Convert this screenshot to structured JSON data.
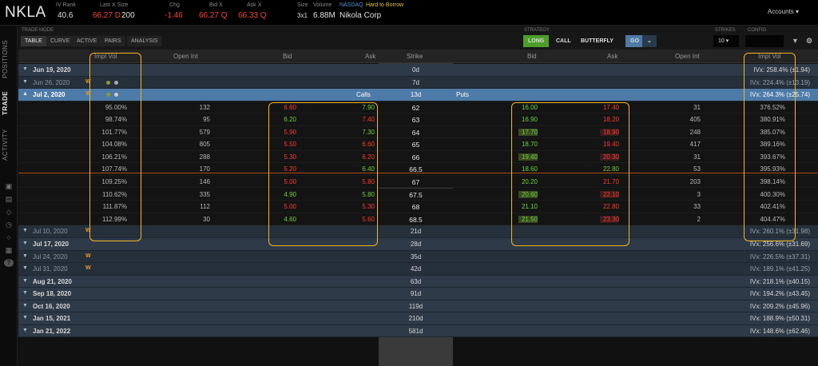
{
  "header": {
    "symbol": "NKLA",
    "iv_rank_label": "IV Rank",
    "iv_rank": "40.6",
    "last_label": "Last X Size",
    "last": "66.27 D",
    "last_size": "200",
    "chg_label": "Chg",
    "chg": "-1.46",
    "bid_label": "Bid X",
    "bid": "66.27 Q",
    "ask_label": "Ask X",
    "ask": "66.33 Q",
    "size_label": "Size",
    "size": "3x1",
    "volume_label": "Volume",
    "volume": "6.88M",
    "exchange": "NASDAQ",
    "htb": "Hard to Borrow",
    "company": "Nikola Corp",
    "accounts": "Accounts"
  },
  "rail": {
    "positions": "POSITIONS",
    "trade": "TRADE",
    "activity": "ACTIVITY"
  },
  "toolbar": {
    "trade_mode_label": "TRADE MODE",
    "modes": [
      "TABLE",
      "CURVE",
      "ACTIVE",
      "PAIRS",
      "ANALYSIS"
    ],
    "strategy_label": "STRATEGY",
    "strategies": [
      "LONG",
      "CALL",
      "BUTTERFLY"
    ],
    "go": "GO",
    "strikes_label": "STRIKES",
    "strikes": "10",
    "config_label": "CONFIG"
  },
  "columns": {
    "impl_vol": "Impl Vol",
    "open_int": "Open Int",
    "bid": "Bid",
    "ask": "Ask",
    "strike": "Strike",
    "bid2": "Bid",
    "ask2": "Ask",
    "open_int2": "Open Int",
    "impl_vol2": "Impl Vol"
  },
  "top_expiries": [
    {
      "date": "Jun 19, 2020",
      "days": "0d",
      "ivx": "IVx: 258.4% (±1.94)",
      "dim": false
    },
    {
      "date": "Jun 26, 2020",
      "days": "7d",
      "ivx": "IVx: 224.4% (±13.19)",
      "dim": true
    }
  ],
  "selected": {
    "date": "Jul 2, 2020",
    "calls": "Calls",
    "days": "13d",
    "puts": "Puts",
    "ivx": "IVx: 264.3% (±25.74)"
  },
  "chain": [
    {
      "civ": "95.00%",
      "coi": "132",
      "cbid": "6.60",
      "cask": "7.90",
      "strike": "62",
      "pbid": "16.00",
      "pask": "17.40",
      "poi": "31",
      "piv": "376.52%"
    },
    {
      "civ": "98.74%",
      "coi": "95",
      "cbid": "6.20",
      "cask": "7.40",
      "strike": "63",
      "pbid": "16.90",
      "pask": "18.20",
      "poi": "405",
      "piv": "380.91%"
    },
    {
      "civ": "101.77%",
      "coi": "579",
      "cbid": "5.90",
      "cask": "7.30",
      "strike": "64",
      "pbid": "17.70",
      "pask": "18.90",
      "poi": "248",
      "piv": "385.07%"
    },
    {
      "civ": "104.08%",
      "coi": "805",
      "cbid": "5.50",
      "cask": "6.60",
      "strike": "65",
      "pbid": "18.70",
      "pask": "19.40",
      "poi": "417",
      "piv": "389.16%"
    },
    {
      "civ": "106.21%",
      "coi": "288",
      "cbid": "5.30",
      "cask": "6.20",
      "strike": "66",
      "pbid": "19.40",
      "pask": "20.30",
      "poi": "31",
      "piv": "393.67%"
    },
    {
      "civ": "107.74%",
      "coi": "170",
      "cbid": "5.20",
      "cask": "6.40",
      "strike": "66.5",
      "pbid": "18.60",
      "pask": "22.80",
      "poi": "53",
      "piv": "395.93%"
    },
    {
      "civ": "109.25%",
      "coi": "146",
      "cbid": "5.00",
      "cask": "5.80",
      "strike": "67",
      "pbid": "20.20",
      "pask": "21.70",
      "poi": "203",
      "piv": "398.14%"
    },
    {
      "civ": "110.62%",
      "coi": "335",
      "cbid": "4.90",
      "cask": "5.80",
      "strike": "67.5",
      "pbid": "20.60",
      "pask": "22.10",
      "poi": "3",
      "piv": "400.30%"
    },
    {
      "civ": "111.87%",
      "coi": "112",
      "cbid": "5.00",
      "cask": "5.30",
      "strike": "68",
      "pbid": "21.10",
      "pask": "22.80",
      "poi": "33",
      "piv": "402.41%"
    },
    {
      "civ": "112.99%",
      "coi": "30",
      "cbid": "4.60",
      "cask": "5.60",
      "strike": "68.5",
      "pbid": "21.50",
      "pask": "23.30",
      "poi": "2",
      "piv": "404.47%"
    }
  ],
  "bottom_expiries": [
    {
      "date": "Jul 10, 2020",
      "days": "21d",
      "ivx": "IVx: 260.1% (±31.98)",
      "dim": true,
      "w": true
    },
    {
      "date": "Jul 17, 2020",
      "days": "28d",
      "ivx": "IVx: 256.6% (±31.69)",
      "dim": false,
      "w": false
    },
    {
      "date": "Jul 24, 2020",
      "days": "35d",
      "ivx": "IVx: 226.5% (±37.31)",
      "dim": true,
      "w": true
    },
    {
      "date": "Jul 31, 2020",
      "days": "42d",
      "ivx": "IVx: 189.1% (±41.25)",
      "dim": true,
      "w": true
    },
    {
      "date": "Aug 21, 2020",
      "days": "63d",
      "ivx": "IVx: 218.1% (±40.15)",
      "dim": false,
      "w": false
    },
    {
      "date": "Sep 18, 2020",
      "days": "91d",
      "ivx": "IVx: 194.2% (±43.45)",
      "dim": false,
      "w": false
    },
    {
      "date": "Oct 16, 2020",
      "days": "119d",
      "ivx": "IVx: 209.2% (±45.96)",
      "dim": false,
      "w": false
    },
    {
      "date": "Jan 15, 2021",
      "days": "210d",
      "ivx": "IVx: 188.9% (±50.31)",
      "dim": false,
      "w": false
    },
    {
      "date": "Jan 21, 2022",
      "days": "581d",
      "ivx": "IVx: 148.6% (±62.46)",
      "dim": false,
      "w": false
    }
  ],
  "weekly_badge": "W",
  "colors": {
    "accent": "#4d7aa6",
    "bid_green": "#6ed13a",
    "ask_red": "#ff3b30",
    "highlight": "#f4b620"
  }
}
